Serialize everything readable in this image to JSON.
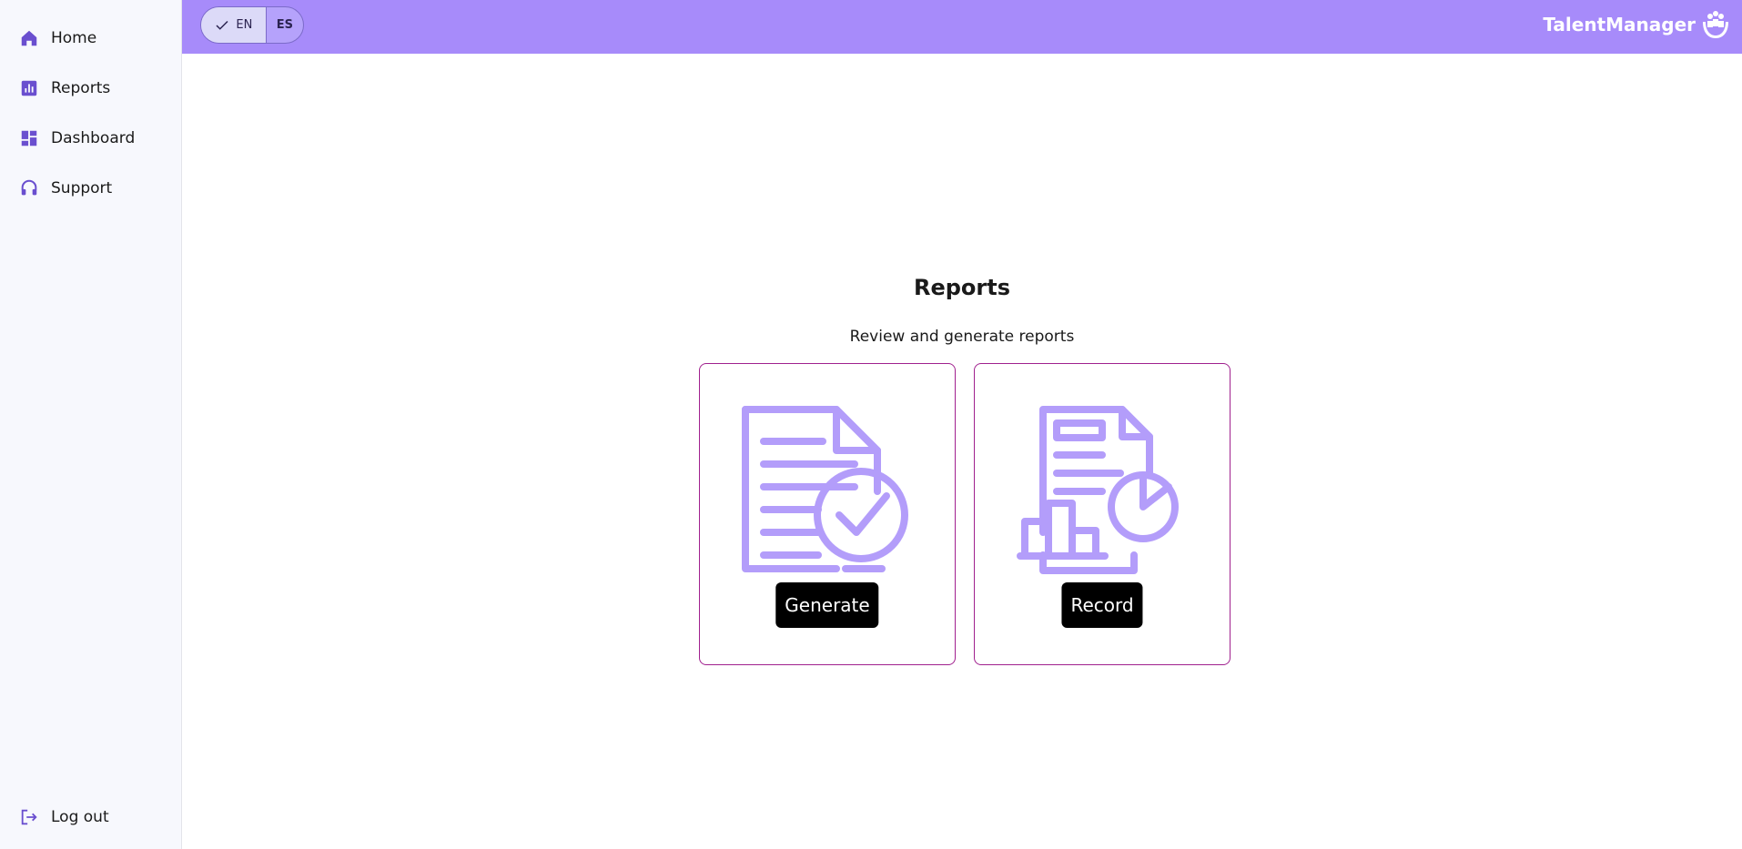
{
  "sidebar": {
    "items": [
      {
        "label": "Home",
        "icon": "home-icon"
      },
      {
        "label": "Reports",
        "icon": "bar-chart-icon"
      },
      {
        "label": "Dashboard",
        "icon": "dashboard-icon"
      },
      {
        "label": "Support",
        "icon": "headset-icon"
      }
    ],
    "logout_label": "Log out",
    "logout_icon": "logout-icon"
  },
  "header": {
    "lang": {
      "en": "EN",
      "es": "ES",
      "selected": "EN"
    },
    "brand": "TalentManager",
    "brand_icon": "hands-people-icon"
  },
  "main": {
    "title": "Reports",
    "subtitle": "Review and generate reports",
    "cards": [
      {
        "button": "Generate",
        "icon": "document-check-icon"
      },
      {
        "button": "Record",
        "icon": "document-chart-icon"
      }
    ]
  },
  "colors": {
    "header_bg": "#a78bfa",
    "accent_icon": "#6a4fcf",
    "illustration": "#b39dfa",
    "card_border": "#a0208e"
  }
}
